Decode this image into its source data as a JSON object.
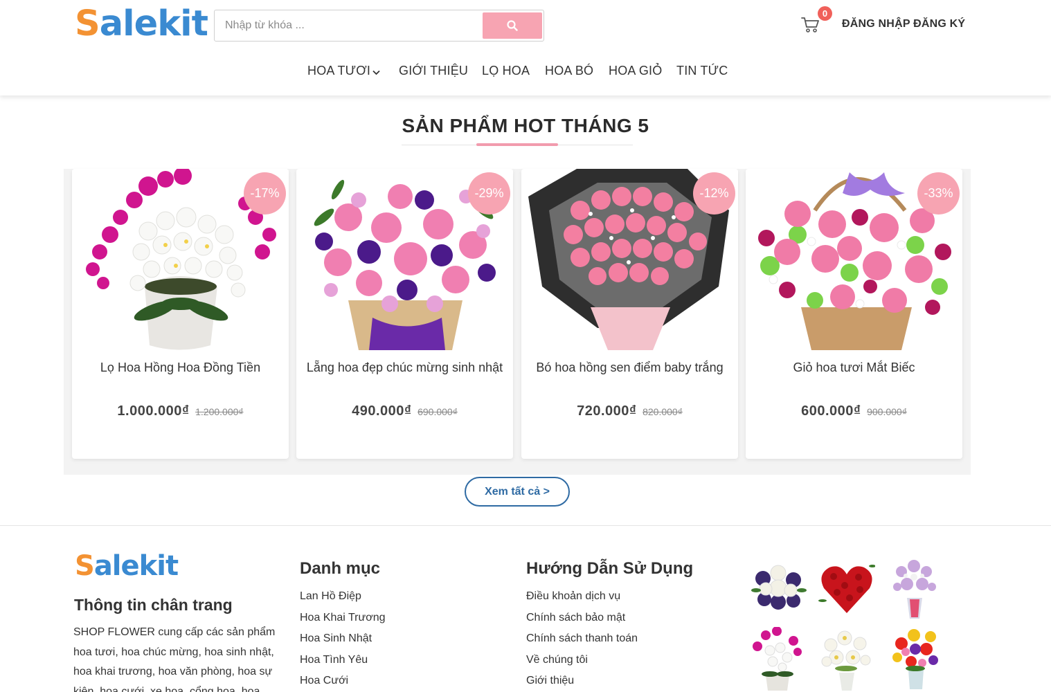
{
  "header": {
    "logo": {
      "part1": "S",
      "part2": "alekit"
    },
    "search": {
      "placeholder": "Nhập từ khóa ..."
    },
    "cart_count": "0",
    "login": "ĐĂNG NHẬP",
    "register": "ĐĂNG KÝ"
  },
  "nav": [
    {
      "label": "HOA TƯƠI"
    },
    {
      "label": "GIỚI THIỆU"
    },
    {
      "label": "LỌ HOA"
    },
    {
      "label": "HOA BÓ"
    },
    {
      "label": "HOA GIỎ"
    },
    {
      "label": "TIN TỨC"
    }
  ],
  "hot": {
    "title": "SẢN PHẨM HOT THÁNG 5",
    "products": [
      {
        "name": "Lọ Hoa Hồng Hoa Đồng Tiền",
        "price": "1.000.000₫",
        "old_price": "1.200.000₫",
        "discount": "-17%"
      },
      {
        "name": "Lẵng hoa đẹp chúc mừng sinh nhật",
        "price": "490.000₫",
        "old_price": "690.000₫",
        "discount": "-29%"
      },
      {
        "name": "Bó hoa hồng sen điểm baby trắng",
        "price": "720.000₫",
        "old_price": "820.000₫",
        "discount": "-12%"
      },
      {
        "name": "Giỏ hoa tươi Mắt Biếc",
        "price": "600.000₫",
        "old_price": "900.000₫",
        "discount": "-33%"
      }
    ],
    "see_all": "Xem tất cả >"
  },
  "footer": {
    "logo": {
      "part1": "S",
      "part2": "alekit"
    },
    "info_title": "Thông tin chân trang",
    "info_text": "SHOP FLOWER cung cấp các sản phẩm hoa tươi, hoa chúc mừng, hoa sinh nhật, hoa khai trương, hoa văn phòng, hoa sự kiện, hoa cưới, xe hoa, cổng hoa, hoa",
    "categories": {
      "title": "Danh mục",
      "items": [
        "Lan Hồ Điệp",
        "Hoa Khai Trương",
        "Hoa Sinh Nhật",
        "Hoa Tình Yêu",
        "Hoa Cưới"
      ]
    },
    "guide": {
      "title": "Hướng Dẫn Sử Dụng",
      "items": [
        "Điều khoản dịch vụ",
        "Chính sách bảo mật",
        "Chính sách thanh toán",
        "Về chúng tôi",
        "Giới thiệu"
      ]
    }
  },
  "colors": {
    "accent_pink": "#f7a4b2",
    "link_blue": "#2e6aa3",
    "logo_orange": "#f39233",
    "logo_blue": "#3a8ad1"
  }
}
